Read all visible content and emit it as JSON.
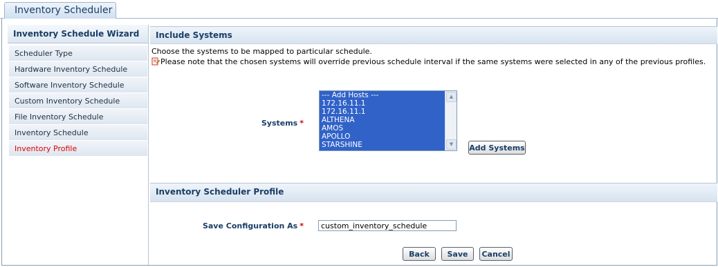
{
  "tab": {
    "title": "Inventory Scheduler"
  },
  "sidebar": {
    "title": "Inventory Schedule Wizard",
    "items": [
      {
        "label": "Scheduler Type"
      },
      {
        "label": "Hardware Inventory Schedule"
      },
      {
        "label": "Software Inventory Schedule"
      },
      {
        "label": "Custom Inventory Schedule"
      },
      {
        "label": "File Inventory Schedule"
      },
      {
        "label": "Inventory Schedule"
      },
      {
        "label": "Inventory Profile"
      }
    ],
    "active_item": "Inventory Profile"
  },
  "include_systems": {
    "heading": "Include Systems",
    "description": "Choose the systems to be mapped to particular schedule.",
    "note": "Please note that the chosen systems will override previous schedule interval if the same systems were selected in any of the previous profiles.",
    "systems_label": "Systems",
    "required_mark": "*",
    "systems_list": [
      "--- Add Hosts ---",
      "172.16.11.1",
      "172.16.11.1",
      "ALTHENA",
      "AMOS",
      "APOLLO",
      "STARSHINE"
    ],
    "add_button": "Add Systems"
  },
  "profile": {
    "heading": "Inventory Scheduler Profile",
    "save_as_label": "Save Configuration As",
    "required_mark": "*",
    "save_as_value": "custom_inventory_schedule"
  },
  "actions": {
    "back": "Back",
    "save": "Save",
    "cancel": "Cancel"
  },
  "colors": {
    "accent": "#1a3e66",
    "selection": "#3162c8",
    "required": "#d00000",
    "active_nav": "#e00000"
  }
}
